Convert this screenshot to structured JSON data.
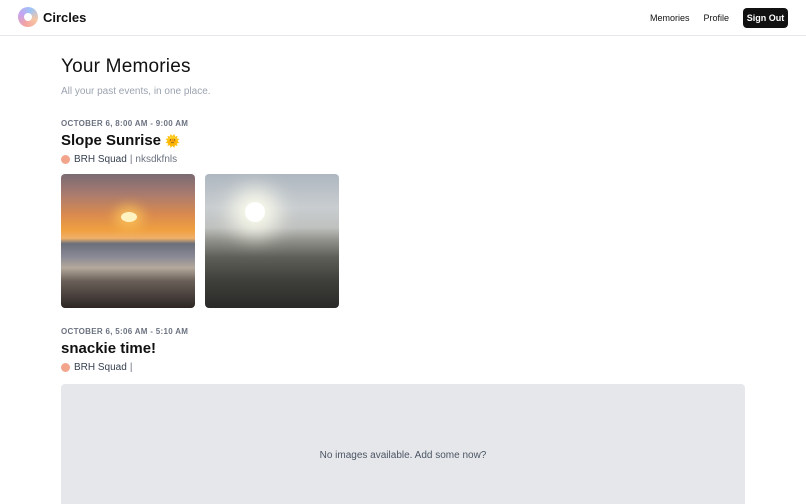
{
  "app": {
    "name": "Circles"
  },
  "nav": {
    "memories": "Memories",
    "profile": "Profile",
    "sign_out": "Sign Out"
  },
  "page": {
    "title": "Your Memories",
    "subtitle": "All your past events, in one place."
  },
  "events": [
    {
      "time": "OCTOBER 6, 8:00 AM - 9:00 AM",
      "title": "Slope Sunrise",
      "title_emoji": "🌞",
      "group": "BRH Squad",
      "separator": "|",
      "user": "nksdkfnls",
      "group_color": "#f2a58a"
    },
    {
      "time": "OCTOBER 6, 5:06 AM - 5:10 AM",
      "title": "snackie time!",
      "group": "BRH Squad",
      "separator": "|",
      "user": "",
      "empty_message": "No images available. Add some now?"
    }
  ]
}
